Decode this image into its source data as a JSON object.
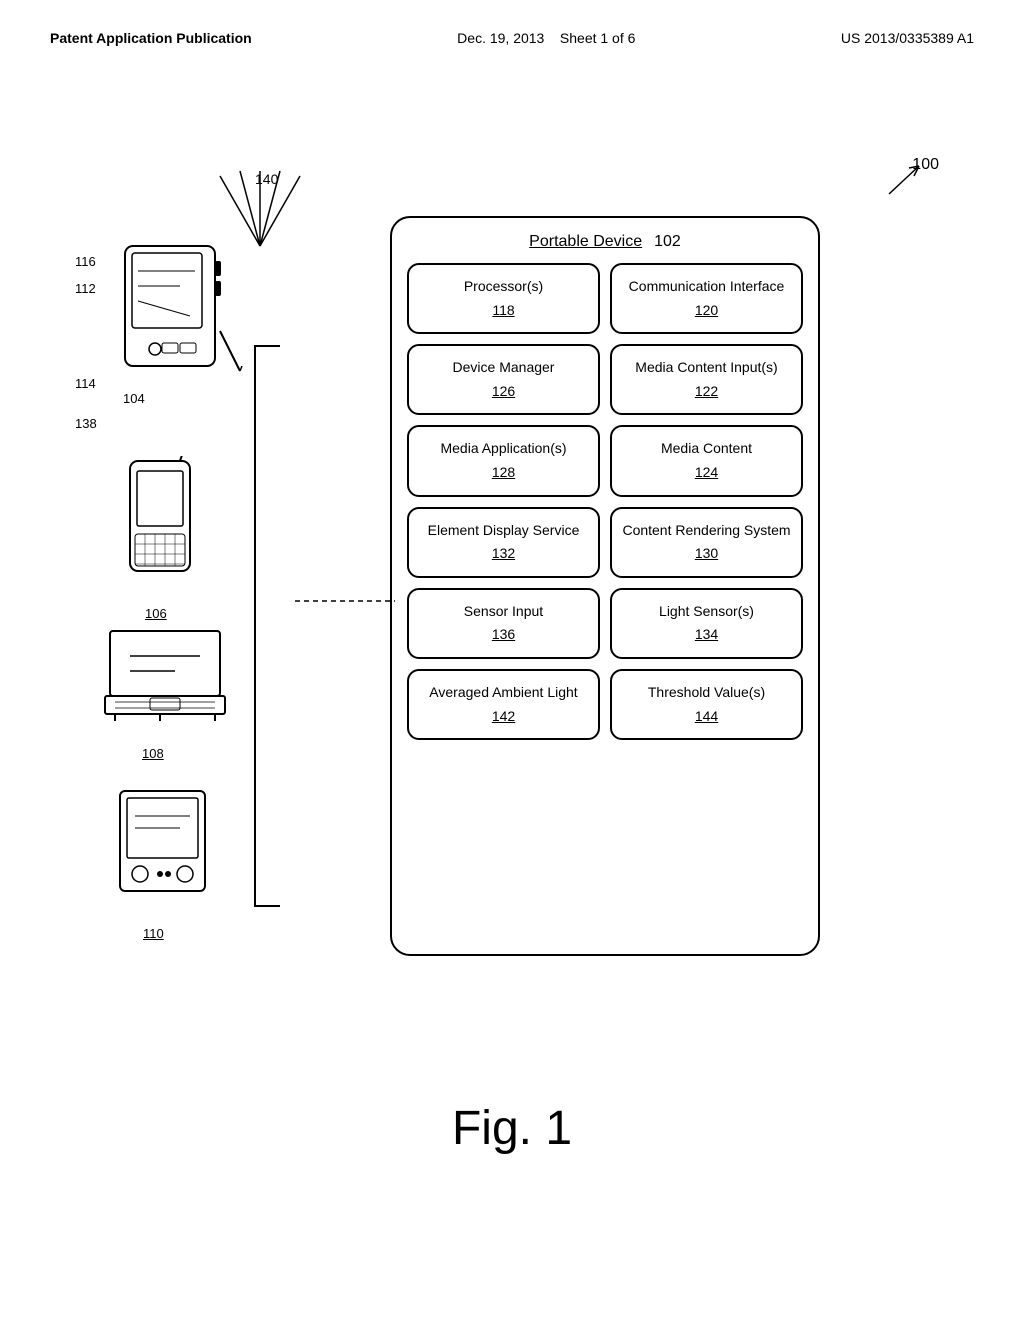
{
  "header": {
    "left": "Patent Application Publication",
    "center_date": "Dec. 19, 2013",
    "center_sheet": "Sheet 1 of 6",
    "right": "US 2013/0335389 A1"
  },
  "diagram": {
    "ref_100": "100",
    "ref_140": "140",
    "ref_116": "116",
    "ref_112": "112",
    "ref_114": "114",
    "ref_104": "104",
    "ref_138": "138",
    "ref_106": "106",
    "ref_108": "108",
    "ref_110": "110",
    "portable_device_label": "Portable Device",
    "portable_device_num": "102",
    "components": [
      {
        "name": "Processor(s)",
        "num": "118"
      },
      {
        "name": "Communication Interface",
        "num": "120"
      },
      {
        "name": "Device Manager",
        "num": "126"
      },
      {
        "name": "Media Content Input(s)",
        "num": "122"
      },
      {
        "name": "Media Application(s)",
        "num": "128"
      },
      {
        "name": "Media Content",
        "num": "124"
      },
      {
        "name": "Element Display Service",
        "num": "132"
      },
      {
        "name": "Content Rendering System",
        "num": "130"
      },
      {
        "name": "Sensor Input",
        "num": "136"
      },
      {
        "name": "Light Sensor(s)",
        "num": "134"
      },
      {
        "name": "Averaged Ambient Light",
        "num": "142"
      },
      {
        "name": "Threshold Value(s)",
        "num": "144"
      }
    ],
    "fig_label": "Fig. 1"
  }
}
